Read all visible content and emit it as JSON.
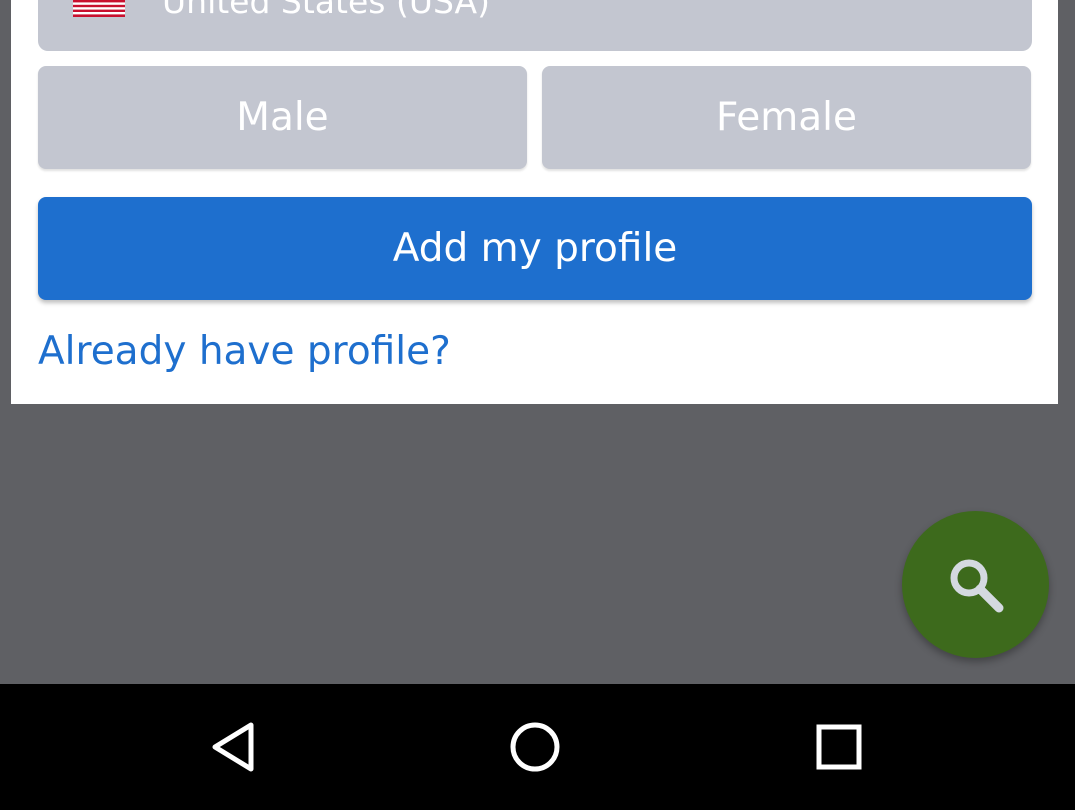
{
  "form": {
    "country": {
      "flag_icon": "us-flag-icon",
      "value": "United States (USA)"
    },
    "gender": {
      "male_label": "Male",
      "female_label": "Female"
    },
    "submit_label": "Add my profile",
    "login_link": "Already have profile?"
  },
  "fab": {
    "icon": "search-icon",
    "color": "#3d6a1c"
  },
  "colors": {
    "accent": "#1e6fce",
    "option_bg": "#c3c6d0",
    "backdrop": "#5f6064"
  },
  "navbar": {
    "buttons": [
      "back-icon",
      "home-icon",
      "recents-icon"
    ]
  }
}
